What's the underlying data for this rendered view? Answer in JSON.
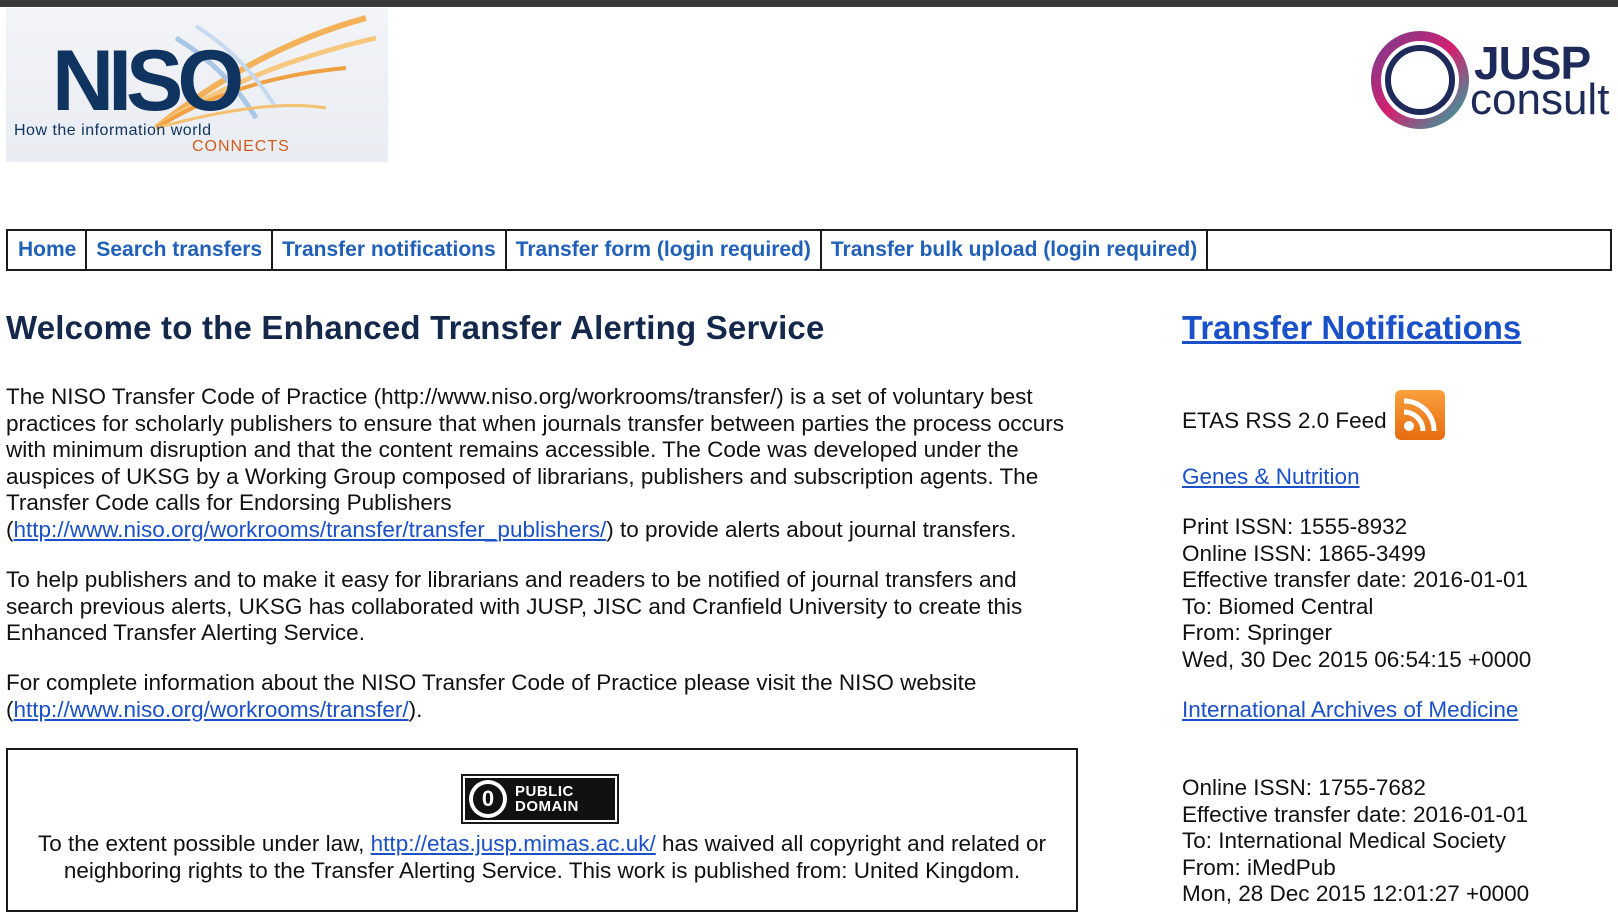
{
  "logos": {
    "niso": {
      "wordmark": "NISO",
      "tagline_line1": "How the information world",
      "tagline_line2": "CONNECTS"
    },
    "jusp": {
      "wordmark": "JUSP",
      "sub": "consult"
    }
  },
  "nav": {
    "items": [
      {
        "label": "Home"
      },
      {
        "label": "Search transfers"
      },
      {
        "label": "Transfer notifications"
      },
      {
        "label": "Transfer form (login required)"
      },
      {
        "label": "Transfer bulk upload (login required)"
      }
    ]
  },
  "main": {
    "title": "Welcome to the Enhanced Transfer Alerting Service",
    "p1_text": "The NISO Transfer Code of Practice (http://www.niso.org/workrooms/transfer/) is a set of voluntary best practices for scholarly publishers to ensure that when journals transfer between parties the process occurs with minimum disruption and that the content remains accessible. The Code was developed under the auspices of UKSG by a Working Group composed of librarians, publishers and subscription agents. The Transfer Code calls for Endorsing Publishers",
    "p1_link": "http://www.niso.org/workrooms/transfer/transfer_publishers/",
    "p1_after": ") to provide alerts about journal transfers.",
    "p2_text": "To help publishers and to make it easy for librarians and readers to be notified of journal transfers and search previous alerts, UKSG has collaborated with JUSP, JISC and Cranfield University to create this Enhanced Transfer Alerting Service.",
    "p3_text": "For complete information about the NISO Transfer Code of Practice please visit the NISO website",
    "p3_link": "http://www.niso.org/workrooms/transfer/",
    "p3_after": ").",
    "license": {
      "badge_zero": "0",
      "badge_line1": "PUBLIC",
      "badge_line2": "DOMAIN",
      "text_before": "To the extent possible under law, ",
      "link": "http://etas.jusp.mimas.ac.uk/",
      "text_after": " has waived all copyright and related or neighboring rights to the Transfer Alerting Service. This work is published from: United Kingdom."
    }
  },
  "sidebar": {
    "title": "Transfer Notifications",
    "rss_label": "ETAS RSS 2.0 Feed",
    "rss_icon": "rss-icon",
    "notifications": [
      {
        "journal": "Genes & Nutrition",
        "lines": [
          "Print ISSN: 1555-8932",
          "Online ISSN: 1865-3499",
          "Effective transfer date: 2016-01-01",
          "To: Biomed Central",
          "From: Springer",
          "Wed, 30 Dec 2015 06:54:15 +0000"
        ]
      },
      {
        "journal": "International Archives of Medicine",
        "lines": [
          "Online ISSN: 1755-7682",
          "Effective transfer date: 2016-01-01",
          "To: International Medical Society",
          "From: iMedPub",
          "Mon, 28 Dec 2015 12:01:27 +0000"
        ]
      }
    ]
  },
  "colors": {
    "link": "#1a50c8",
    "nav_link": "#2060b8",
    "title": "#14284b",
    "rss": "#f28a1e"
  }
}
